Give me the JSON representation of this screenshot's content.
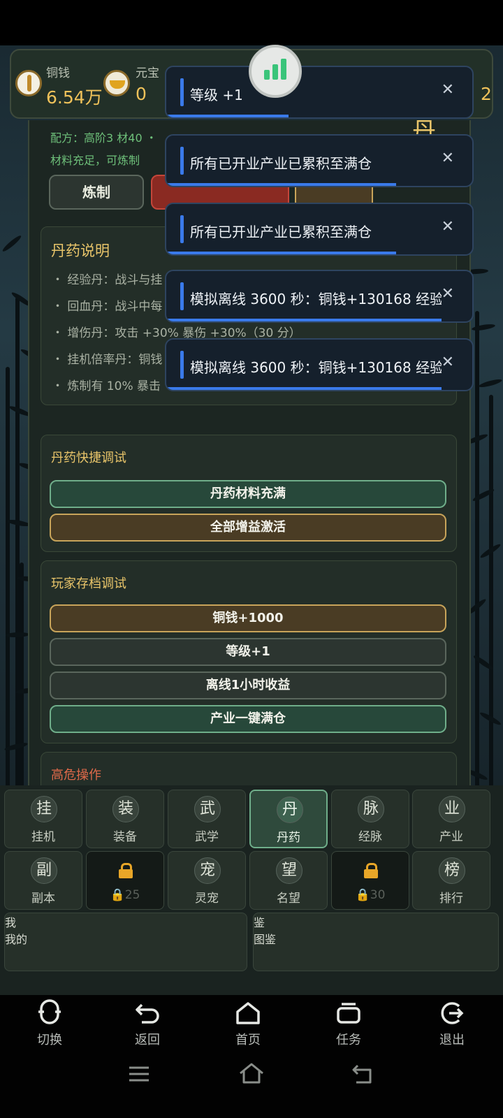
{
  "resources": {
    "copper_label": "铜钱",
    "copper_value": "6.54万",
    "ingot_label": "元宝",
    "ingot_value": "0",
    "right_partial": "2"
  },
  "alchemy": {
    "recipe_line": "配方：高阶3 材40 ・",
    "status_line": "材料充足，可炼制",
    "craft_label": "炼制",
    "right_char": "丹"
  },
  "description": {
    "title": "丹药说明",
    "lines": [
      "・ 经验丹：战斗与挂",
      "・ 回血丹：战斗中每",
      "・ 增伤丹：攻击 +30% 暴伤 +30%（30 分）",
      "・ 挂机倍率丹：铜钱",
      "・ 炼制有 10% 暴击"
    ]
  },
  "quick_debug": {
    "title": "丹药快捷调试",
    "buttons": [
      "丹药材料充满",
      "全部增益激活"
    ]
  },
  "save_debug": {
    "title": "玩家存档调试",
    "buttons": [
      "铜钱+1000",
      "等级+1",
      "离线1小时收益",
      "产业一键满仓"
    ]
  },
  "danger": {
    "title": "高危操作"
  },
  "toasts": [
    {
      "text": "等级 +1",
      "progress": 0.4
    },
    {
      "text": "所有已开业产业已累积至满仓",
      "progress": 0.75
    },
    {
      "text": "所有已开业产业已累积至满仓",
      "progress": 0.75
    },
    {
      "text": "模拟离线 3600 秒：铜钱+130168 经验+",
      "progress": 0.9
    },
    {
      "text": "模拟离线 3600 秒：铜钱+130168 经验+",
      "progress": 0.9
    }
  ],
  "toast_close": "✕",
  "nav": {
    "row1": [
      {
        "icon": "挂",
        "label": "挂机"
      },
      {
        "icon": "装",
        "label": "装备"
      },
      {
        "icon": "武",
        "label": "武学"
      },
      {
        "icon": "丹",
        "label": "丹药",
        "active": true
      },
      {
        "icon": "脉",
        "label": "经脉"
      },
      {
        "icon": "业",
        "label": "产业"
      }
    ],
    "row2": [
      {
        "icon": "副",
        "label": "副本"
      },
      {
        "locked": true,
        "label": "25"
      },
      {
        "icon": "宠",
        "label": "灵宠"
      },
      {
        "icon": "望",
        "label": "名望"
      },
      {
        "locked": true,
        "label": "30"
      },
      {
        "icon": "榜",
        "label": "排行"
      }
    ],
    "row3": [
      {
        "icon": "我",
        "label": "我的"
      },
      {
        "icon": "鉴",
        "label": "图鉴"
      }
    ]
  },
  "system_bar": [
    "切换",
    "返回",
    "首页",
    "任务",
    "退出"
  ],
  "colors": {
    "accent_gold": "#e9c56a",
    "accent_green": "#6fae8a",
    "toast_blue": "#3a7aea",
    "danger_red": "#e06a4a"
  }
}
